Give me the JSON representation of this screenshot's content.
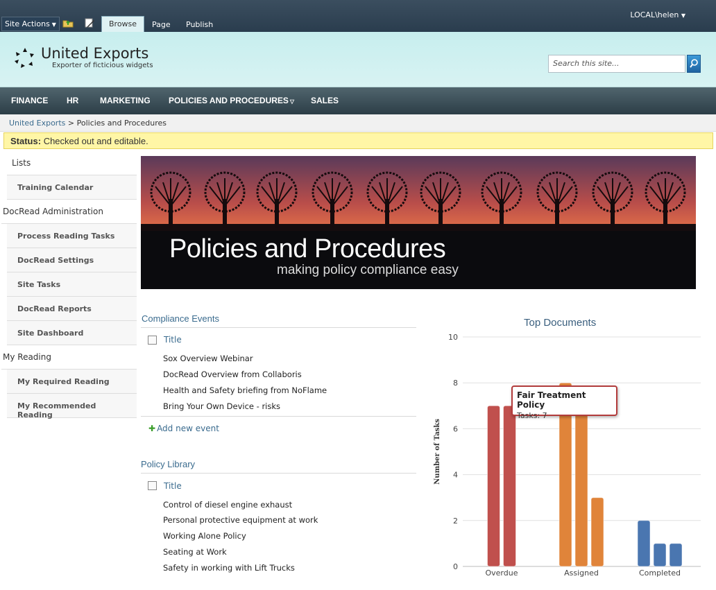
{
  "ribbon": {
    "site_actions": "Site Actions",
    "tabs": [
      "Browse",
      "Page",
      "Publish"
    ],
    "user": "LOCAL\\helen"
  },
  "header": {
    "title": "United Exports",
    "subtitle": "Exporter of ficticious widgets",
    "search_placeholder": "Search this site..."
  },
  "topnav": [
    "FINANCE",
    "HR",
    "MARKETING",
    "POLICIES AND PROCEDURES",
    "SALES"
  ],
  "breadcrumb": {
    "root": "United Exports",
    "current": "> Policies and Procedures"
  },
  "status": {
    "label": "Status:",
    "text": "Checked out and editable."
  },
  "quicklaunch": [
    {
      "type": "head",
      "label": "Lists"
    },
    {
      "type": "item",
      "label": "Training Calendar"
    },
    {
      "type": "head",
      "label": "DocRead Administration"
    },
    {
      "type": "item",
      "label": "Process Reading Tasks"
    },
    {
      "type": "item",
      "label": "DocRead Settings"
    },
    {
      "type": "item",
      "label": "Site Tasks"
    },
    {
      "type": "item",
      "label": "DocRead Reports"
    },
    {
      "type": "item",
      "label": "Site Dashboard"
    },
    {
      "type": "head",
      "label": "My Reading"
    },
    {
      "type": "item",
      "label": "My Required Reading"
    },
    {
      "type": "item",
      "label": "My Recommended Reading"
    }
  ],
  "banner": {
    "title": "Policies and Procedures",
    "subtitle": "making policy compliance easy"
  },
  "compliance": {
    "title": "Compliance Events",
    "column": "Title",
    "rows": [
      "Sox Overview Webinar",
      "DocRead Overview from Collaboris",
      "Health and Safety briefing from NoFlame",
      "Bring Your Own Device - risks"
    ],
    "add_new": "Add new event"
  },
  "library": {
    "title": "Policy Library",
    "column": "Title",
    "rows": [
      "Control of diesel engine exhaust",
      "Personal protective equipment at work",
      "Working Alone Policy",
      "Seating at Work",
      "Safety in working with Lift Trucks"
    ]
  },
  "chart_data": {
    "type": "bar",
    "title": "Top Documents",
    "ylabel": "Number of Tasks",
    "ylim": [
      0,
      10
    ],
    "yticks": [
      0,
      2,
      4,
      6,
      8,
      10
    ],
    "categories": [
      "Overdue",
      "Assigned",
      "Completed"
    ],
    "groups": [
      {
        "category": "Overdue",
        "color": "#c0504d",
        "values": [
          7,
          7
        ]
      },
      {
        "category": "Assigned",
        "color": "#e0843a",
        "values": [
          8,
          7,
          3
        ]
      },
      {
        "category": "Completed",
        "color": "#4a76b0",
        "values": [
          2,
          1,
          1
        ]
      }
    ],
    "tooltip": {
      "title": "Fair Treatment Policy",
      "text": "Tasks: 7"
    },
    "grid": true
  }
}
